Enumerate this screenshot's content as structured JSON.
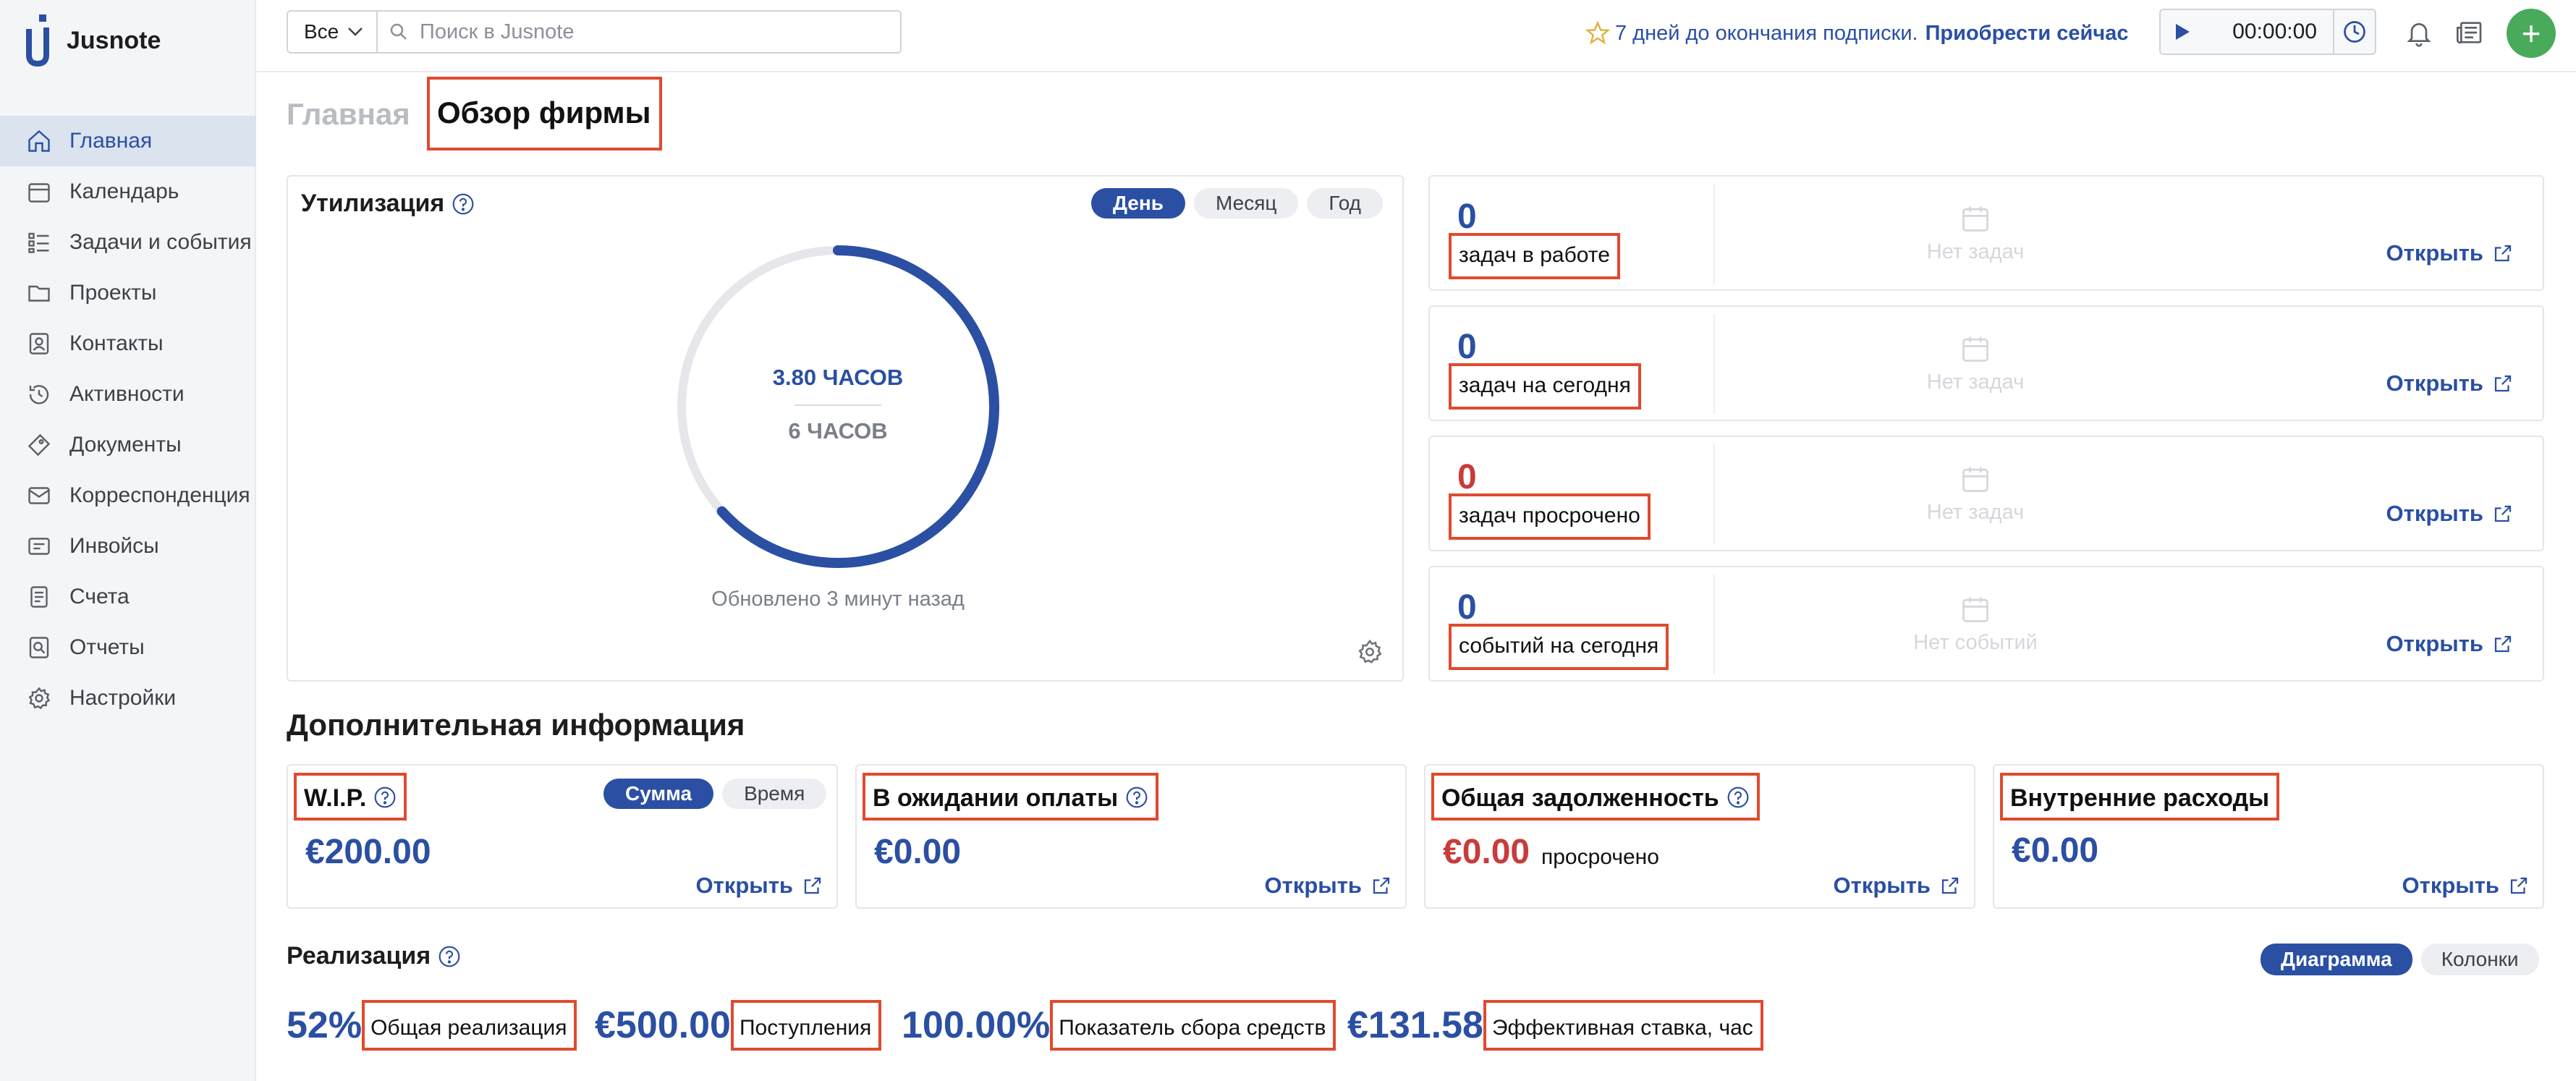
{
  "app": {
    "name": "Jusnote"
  },
  "sidebar": {
    "items": [
      {
        "label": "Главная",
        "icon": "home-icon",
        "active": true
      },
      {
        "label": "Календарь",
        "icon": "calendar-icon"
      },
      {
        "label": "Задачи и события",
        "icon": "tasks-icon"
      },
      {
        "label": "Проекты",
        "icon": "folder-icon"
      },
      {
        "label": "Контакты",
        "icon": "contacts-icon"
      },
      {
        "label": "Активности",
        "icon": "activity-icon"
      },
      {
        "label": "Документы",
        "icon": "documents-icon"
      },
      {
        "label": "Корреспонденция",
        "icon": "mail-icon"
      },
      {
        "label": "Инвойсы",
        "icon": "invoice-icon"
      },
      {
        "label": "Счета",
        "icon": "bill-icon"
      },
      {
        "label": "Отчеты",
        "icon": "reports-icon"
      },
      {
        "label": "Настройки",
        "icon": "settings-icon"
      }
    ]
  },
  "header": {
    "scope": "Все",
    "search_placeholder": "Поиск в Jusnote",
    "promo_text": "7 дней до окончания подписки.",
    "promo_link": "Приобрести сейчас",
    "timer": "00:00:00",
    "add_label": "+"
  },
  "page_tabs": {
    "home": "Главная",
    "overview": "Обзор фирмы"
  },
  "utilization": {
    "title": "Утилизация",
    "periods": [
      "День",
      "Месяц",
      "Год"
    ],
    "value": "3.80 ЧАСОВ",
    "target": "6 ЧАСОВ",
    "progress": 0.633,
    "updated": "Обновлено 3 минут назад"
  },
  "tasks": [
    {
      "count": "0",
      "label": "задач в работе",
      "empty": "Нет задач",
      "open": "Открыть"
    },
    {
      "count": "0",
      "label": "задач на сегодня",
      "empty": "Нет задач",
      "open": "Открыть"
    },
    {
      "count": "0",
      "label": "задач просрочено",
      "empty": "Нет задач",
      "open": "Открыть"
    },
    {
      "count": "0",
      "label": "событий на сегодня",
      "empty": "Нет событий",
      "open": "Открыть"
    }
  ],
  "additional": {
    "title": "Дополнительная информация",
    "wip": {
      "title": "W.I.P.",
      "toggle": [
        "Сумма",
        "Время"
      ],
      "value": "€200.00",
      "open": "Открыть"
    },
    "awaiting": {
      "title": "В ожидании оплаты",
      "value": "€0.00",
      "open": "Открыть"
    },
    "debt": {
      "title": "Общая задолженность",
      "value": "€0.00",
      "suffix": "просрочено",
      "open": "Открыть"
    },
    "internal": {
      "title": "Внутренние расходы",
      "value": "€0.00",
      "open": "Открыть"
    }
  },
  "realization": {
    "title": "Реализация",
    "views": [
      "Диаграмма",
      "Колонки"
    ],
    "metrics": [
      {
        "value": "52%",
        "label": "Общая реализация"
      },
      {
        "value": "€500.00",
        "label": "Поступления"
      },
      {
        "value": "100.00%",
        "label": "Показатель сбора средств"
      },
      {
        "value": "€131.58",
        "label": "Эффективная ставка, час"
      }
    ]
  },
  "colors": {
    "accent": "#2a4fa3",
    "danger": "#c93b3b",
    "add": "#4aaa5c",
    "highlight": "#e04a2e"
  }
}
